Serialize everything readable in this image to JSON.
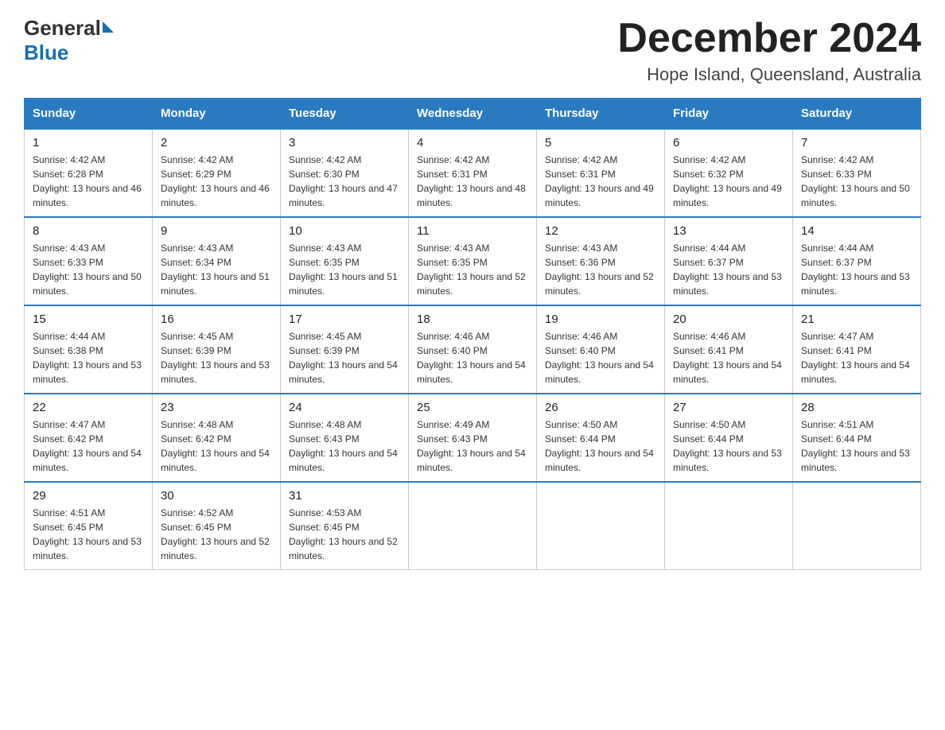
{
  "header": {
    "logo_general": "General",
    "logo_blue": "Blue",
    "month_title": "December 2024",
    "location": "Hope Island, Queensland, Australia"
  },
  "days_of_week": [
    "Sunday",
    "Monday",
    "Tuesday",
    "Wednesday",
    "Thursday",
    "Friday",
    "Saturday"
  ],
  "weeks": [
    [
      {
        "day": "1",
        "sunrise": "4:42 AM",
        "sunset": "6:28 PM",
        "daylight": "13 hours and 46 minutes."
      },
      {
        "day": "2",
        "sunrise": "4:42 AM",
        "sunset": "6:29 PM",
        "daylight": "13 hours and 46 minutes."
      },
      {
        "day": "3",
        "sunrise": "4:42 AM",
        "sunset": "6:30 PM",
        "daylight": "13 hours and 47 minutes."
      },
      {
        "day": "4",
        "sunrise": "4:42 AM",
        "sunset": "6:31 PM",
        "daylight": "13 hours and 48 minutes."
      },
      {
        "day": "5",
        "sunrise": "4:42 AM",
        "sunset": "6:31 PM",
        "daylight": "13 hours and 49 minutes."
      },
      {
        "day": "6",
        "sunrise": "4:42 AM",
        "sunset": "6:32 PM",
        "daylight": "13 hours and 49 minutes."
      },
      {
        "day": "7",
        "sunrise": "4:42 AM",
        "sunset": "6:33 PM",
        "daylight": "13 hours and 50 minutes."
      }
    ],
    [
      {
        "day": "8",
        "sunrise": "4:43 AM",
        "sunset": "6:33 PM",
        "daylight": "13 hours and 50 minutes."
      },
      {
        "day": "9",
        "sunrise": "4:43 AM",
        "sunset": "6:34 PM",
        "daylight": "13 hours and 51 minutes."
      },
      {
        "day": "10",
        "sunrise": "4:43 AM",
        "sunset": "6:35 PM",
        "daylight": "13 hours and 51 minutes."
      },
      {
        "day": "11",
        "sunrise": "4:43 AM",
        "sunset": "6:35 PM",
        "daylight": "13 hours and 52 minutes."
      },
      {
        "day": "12",
        "sunrise": "4:43 AM",
        "sunset": "6:36 PM",
        "daylight": "13 hours and 52 minutes."
      },
      {
        "day": "13",
        "sunrise": "4:44 AM",
        "sunset": "6:37 PM",
        "daylight": "13 hours and 53 minutes."
      },
      {
        "day": "14",
        "sunrise": "4:44 AM",
        "sunset": "6:37 PM",
        "daylight": "13 hours and 53 minutes."
      }
    ],
    [
      {
        "day": "15",
        "sunrise": "4:44 AM",
        "sunset": "6:38 PM",
        "daylight": "13 hours and 53 minutes."
      },
      {
        "day": "16",
        "sunrise": "4:45 AM",
        "sunset": "6:39 PM",
        "daylight": "13 hours and 53 minutes."
      },
      {
        "day": "17",
        "sunrise": "4:45 AM",
        "sunset": "6:39 PM",
        "daylight": "13 hours and 54 minutes."
      },
      {
        "day": "18",
        "sunrise": "4:46 AM",
        "sunset": "6:40 PM",
        "daylight": "13 hours and 54 minutes."
      },
      {
        "day": "19",
        "sunrise": "4:46 AM",
        "sunset": "6:40 PM",
        "daylight": "13 hours and 54 minutes."
      },
      {
        "day": "20",
        "sunrise": "4:46 AM",
        "sunset": "6:41 PM",
        "daylight": "13 hours and 54 minutes."
      },
      {
        "day": "21",
        "sunrise": "4:47 AM",
        "sunset": "6:41 PM",
        "daylight": "13 hours and 54 minutes."
      }
    ],
    [
      {
        "day": "22",
        "sunrise": "4:47 AM",
        "sunset": "6:42 PM",
        "daylight": "13 hours and 54 minutes."
      },
      {
        "day": "23",
        "sunrise": "4:48 AM",
        "sunset": "6:42 PM",
        "daylight": "13 hours and 54 minutes."
      },
      {
        "day": "24",
        "sunrise": "4:48 AM",
        "sunset": "6:43 PM",
        "daylight": "13 hours and 54 minutes."
      },
      {
        "day": "25",
        "sunrise": "4:49 AM",
        "sunset": "6:43 PM",
        "daylight": "13 hours and 54 minutes."
      },
      {
        "day": "26",
        "sunrise": "4:50 AM",
        "sunset": "6:44 PM",
        "daylight": "13 hours and 54 minutes."
      },
      {
        "day": "27",
        "sunrise": "4:50 AM",
        "sunset": "6:44 PM",
        "daylight": "13 hours and 53 minutes."
      },
      {
        "day": "28",
        "sunrise": "4:51 AM",
        "sunset": "6:44 PM",
        "daylight": "13 hours and 53 minutes."
      }
    ],
    [
      {
        "day": "29",
        "sunrise": "4:51 AM",
        "sunset": "6:45 PM",
        "daylight": "13 hours and 53 minutes."
      },
      {
        "day": "30",
        "sunrise": "4:52 AM",
        "sunset": "6:45 PM",
        "daylight": "13 hours and 52 minutes."
      },
      {
        "day": "31",
        "sunrise": "4:53 AM",
        "sunset": "6:45 PM",
        "daylight": "13 hours and 52 minutes."
      },
      null,
      null,
      null,
      null
    ]
  ]
}
